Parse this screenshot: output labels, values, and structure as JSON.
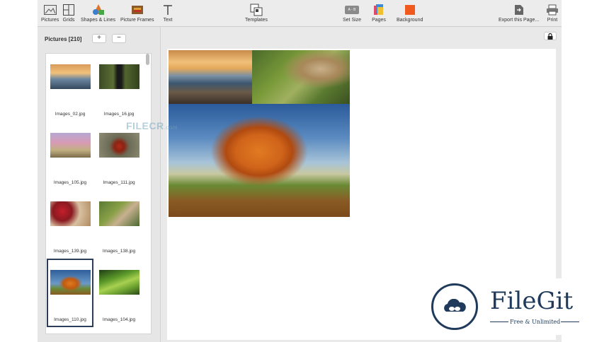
{
  "toolbar": {
    "pictures_label": "Pictures",
    "grids_label": "Grids",
    "shapes_label": "Shapes & Lines",
    "frames_label": "Picture Frames",
    "text_label": "Text",
    "templates_label": "Templates",
    "setsize_label": "Set Size",
    "setsize_glyph": "A ◦ B",
    "pages_label": "Pages",
    "background_label": "Background",
    "export_label": "Export this Page...",
    "print_label": "Print"
  },
  "sidebar": {
    "title": "Pictures [210]",
    "add_label": "+",
    "remove_label": "−",
    "thumbnails": [
      {
        "caption": "Images_02.jpg",
        "selected": false
      },
      {
        "caption": "Images_16.jpg",
        "selected": false
      },
      {
        "caption": "Images_105.jpg",
        "selected": false
      },
      {
        "caption": "Images_111.jpg",
        "selected": false
      },
      {
        "caption": "Images_139.jpg",
        "selected": false
      },
      {
        "caption": "Images_138.jpg",
        "selected": false
      },
      {
        "caption": "Images_110.jpg",
        "selected": true
      },
      {
        "caption": "Images_104.jpg",
        "selected": false
      }
    ]
  },
  "watermark": {
    "brand": "FILECR",
    "domain": ".com"
  },
  "logo": {
    "name": "FileGit",
    "tagline": "Free & Unlimited"
  },
  "colors": {
    "accent_navy": "#1f3a5a",
    "background_icon": "#f05a1e",
    "selection": "#2b3d59"
  }
}
